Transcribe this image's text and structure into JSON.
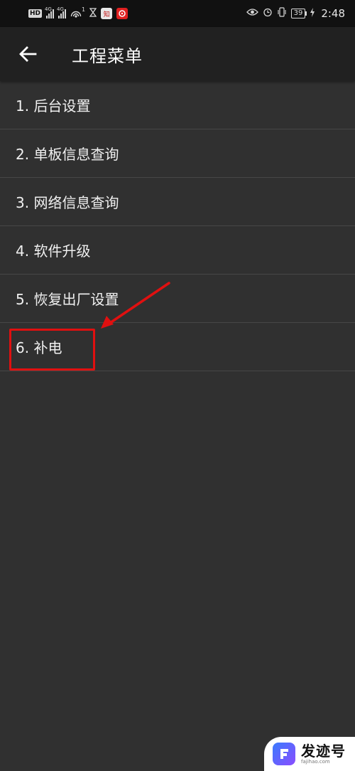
{
  "status_bar": {
    "badge": "HD",
    "signal1_label": "4G",
    "signal2_label": "4G",
    "hotspot_count": "1",
    "app_badge": "知",
    "battery": "39",
    "time": "2:48"
  },
  "app_bar": {
    "title": "工程菜单"
  },
  "menu": {
    "items": [
      {
        "label": "1. 后台设置"
      },
      {
        "label": "2. 单板信息查询"
      },
      {
        "label": "3. 网络信息查询"
      },
      {
        "label": "4. 软件升级"
      },
      {
        "label": "5. 恢复出厂设置"
      },
      {
        "label": "6. 补电"
      }
    ]
  },
  "watermark": {
    "name": "发迹号",
    "site": "fajihao.com"
  },
  "colors": {
    "background": "#303030",
    "app_bar": "#212121",
    "annotation": "#e01010"
  }
}
